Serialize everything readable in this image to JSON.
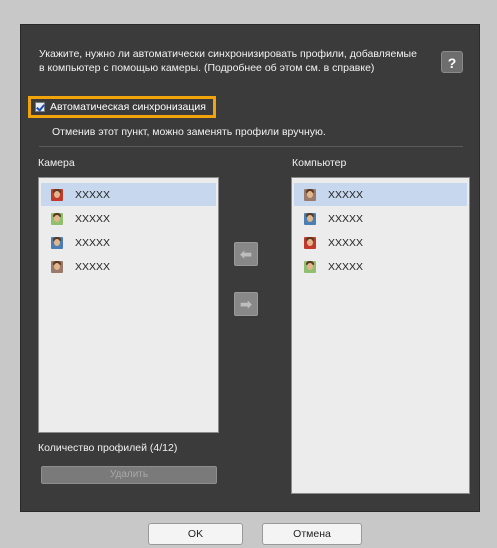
{
  "description": "Укажите, нужно ли автоматически синхронизировать профили, добавляемые в компьютер с помощью камеры. (Подробнее об этом см. в справке)",
  "help_label": "?",
  "auto_sync": {
    "label": "Автоматическая синхронизация",
    "checked": true
  },
  "note": "Отменив этот пункт, можно заменять профили вручную.",
  "camera": {
    "title": "Камера",
    "items": [
      {
        "label": "XXXXX",
        "selected": true,
        "avatar_bg": "#c0392b"
      },
      {
        "label": "XXXXX",
        "selected": false,
        "avatar_bg": "#8fbf6f"
      },
      {
        "label": "XXXXX",
        "selected": false,
        "avatar_bg": "#4b7fb3"
      },
      {
        "label": "XXXXX",
        "selected": false,
        "avatar_bg": "#9a7a6a"
      }
    ]
  },
  "computer": {
    "title": "Компьютер",
    "items": [
      {
        "label": "XXXXX",
        "selected": true,
        "avatar_bg": "#9a7a6a"
      },
      {
        "label": "XXXXX",
        "selected": false,
        "avatar_bg": "#4b7fb3"
      },
      {
        "label": "XXXXX",
        "selected": false,
        "avatar_bg": "#c0392b"
      },
      {
        "label": "XXXXX",
        "selected": false,
        "avatar_bg": "#8fbf6f"
      }
    ]
  },
  "arrows": {
    "left": "⬅",
    "right": "➡"
  },
  "profile_count": "Количество профилей (4/12)",
  "delete_label": "Удалить",
  "ok_label": "OK",
  "cancel_label": "Отмена",
  "colors": {
    "highlight": "#f0a30a",
    "panel": "#3b3b3b",
    "selected_row": "#c6d7ee"
  }
}
